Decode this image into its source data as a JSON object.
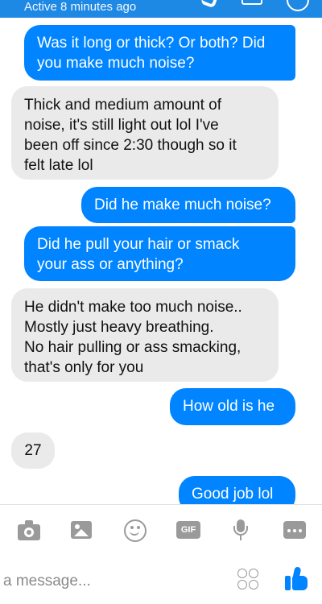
{
  "header": {
    "status": "Active 8 minutes ago"
  },
  "messages": [
    {
      "direction": "outgoing",
      "text": "Was it long or thick? Or both? Did\nyou make much noise?"
    },
    {
      "direction": "incoming",
      "text": "Thick and medium amount of\nnoise, it's still light out lol I've\nbeen off since 2:30 though so it\nfelt late lol"
    },
    {
      "direction": "outgoing",
      "text": "Did he make much noise?"
    },
    {
      "direction": "outgoing",
      "text": "Did he pull your hair or smack\nyour ass or anything?"
    },
    {
      "direction": "incoming",
      "text": "He didn't make too much noise..\nMostly just heavy breathing.\nNo hair pulling or ass smacking,\nthat's only for you"
    },
    {
      "direction": "outgoing",
      "text": "How old is he"
    },
    {
      "direction": "incoming",
      "text": "27"
    },
    {
      "direction": "outgoing",
      "text": "Good job lol"
    }
  ],
  "toolbar": {
    "icons": [
      "camera-icon",
      "image-icon",
      "emoji-icon",
      "gif-icon",
      "microphone-icon",
      "more-icon"
    ],
    "gif_label": "GIF"
  },
  "composer": {
    "placeholder": "a message...",
    "value": ""
  },
  "colors": {
    "outgoing_bubble": "#0084ff",
    "incoming_bubble": "#eaeaea",
    "icon_gray": "#9a9a9a",
    "like_blue": "#0084ff"
  }
}
